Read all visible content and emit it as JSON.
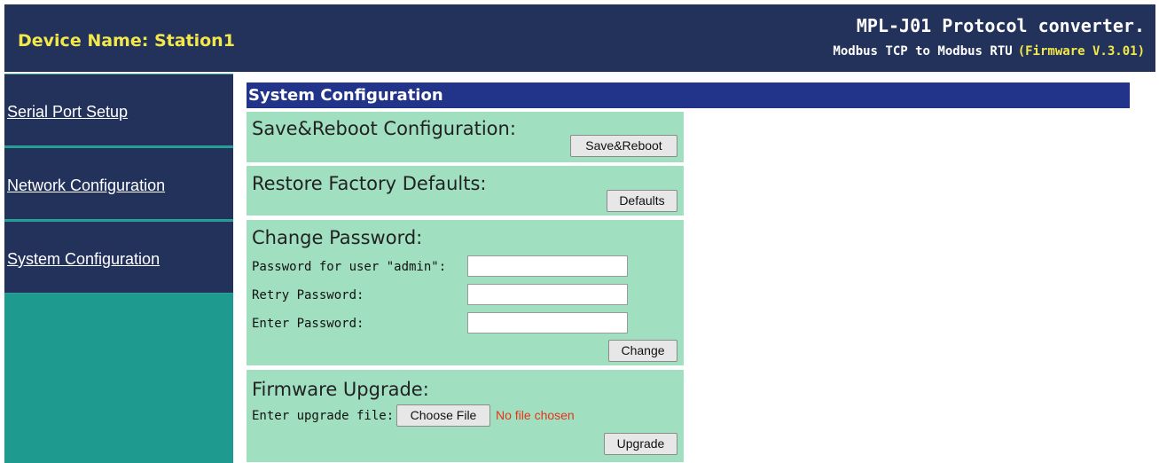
{
  "header": {
    "device_name_label": "Device Name: Station1",
    "product": "MPL-J01 Protocol converter.",
    "subtitle": "Modbus TCP to Modbus RTU",
    "firmware": "(Firmware V.3.01)"
  },
  "sidebar": {
    "items": [
      {
        "label": "Serial Port Setup"
      },
      {
        "label": "Network Configuration"
      },
      {
        "label": "System Configuration"
      }
    ]
  },
  "main": {
    "title": "System Configuration",
    "save": {
      "heading": "Save&Reboot Configuration:",
      "button": "Save&Reboot"
    },
    "restore": {
      "heading": "Restore Factory Defaults:",
      "button": "Defaults"
    },
    "password": {
      "heading": "Change Password:",
      "user_label": "Password for user \"admin\":",
      "user_value": "",
      "retry_label": "Retry Password:",
      "retry_value": "",
      "enter_label": "Enter Password:",
      "enter_value": "",
      "button": "Change"
    },
    "firmware": {
      "heading": "Firmware Upgrade:",
      "file_label": "Enter upgrade file:",
      "choose_button": "Choose File",
      "no_file": "No file chosen",
      "button": "Upgrade"
    }
  },
  "colors": {
    "header_bg": "#23325a",
    "accent_yellow": "#f2e84b",
    "sidebar_bg": "#23325a",
    "sidebar_fill": "#1e9a8e",
    "title_bar": "#22338a",
    "panel_bg": "#a0e0c0",
    "no_file_red": "#e8321a"
  }
}
